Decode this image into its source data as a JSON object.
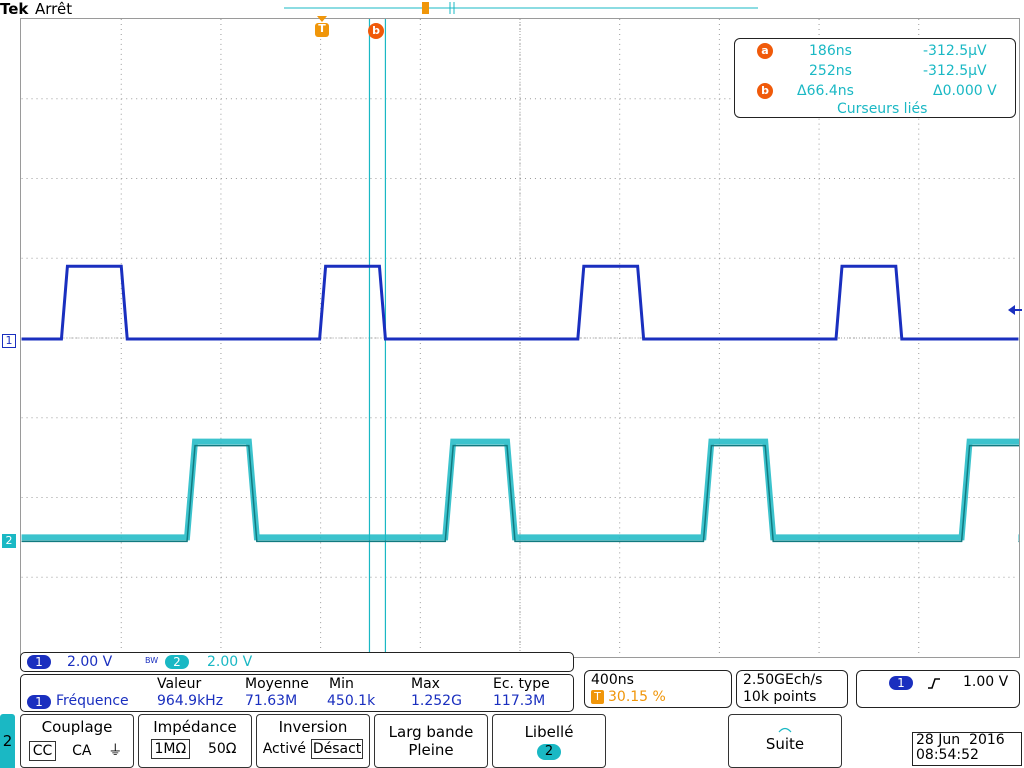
{
  "header": {
    "brand": "Tek",
    "state": "Arrêt"
  },
  "markers": {
    "trigger": "T",
    "cursor_a": "a",
    "cursor_b": "b"
  },
  "channel_markers": {
    "ch1": "1",
    "ch2": "2"
  },
  "cursor_readout": {
    "a_time": "186ns",
    "a_value": "-312.5μV",
    "b_time": "252ns",
    "b_value": "-312.5μV",
    "delta_time": "Δ66.4ns",
    "delta_value": "Δ0.000 V",
    "mode": "Curseurs liés"
  },
  "channel_settings": {
    "ch1_id": "1",
    "ch1_scale": "2.00 V",
    "bw_marker": "BW",
    "ch2_id": "2",
    "ch2_scale": "2.00 V"
  },
  "measurement": {
    "headers": {
      "value": "Valeur",
      "mean": "Moyenne",
      "min": "Min",
      "max": "Max",
      "std": "Ec. type"
    },
    "channel": "1",
    "label": "Fréquence",
    "value": "964.9kHz",
    "mean": "71.63M",
    "min": "450.1k",
    "max": "1.252G",
    "std": "117.3M"
  },
  "timebase": {
    "scale": "400ns",
    "trigger_icon": "T",
    "position": "30.15 %"
  },
  "acquisition": {
    "rate": "2.50GEch/s",
    "points": "10k points"
  },
  "trigger": {
    "channel": "1",
    "slope_icon": "rising-edge",
    "level": "1.00 V"
  },
  "menu": {
    "side_channel": "2",
    "coupling": {
      "title": "Couplage",
      "options": [
        "CC",
        "CA",
        "⏚"
      ],
      "selected": 0
    },
    "impedance": {
      "title": "Impédance",
      "options": [
        "1MΩ",
        "50Ω"
      ],
      "selected": 0
    },
    "inversion": {
      "title": "Inversion",
      "options": [
        "Activé",
        "Désact"
      ],
      "selected": 1
    },
    "bandwidth": {
      "title": "Larg bande",
      "value": "Pleine"
    },
    "label": {
      "title": "Libellé",
      "value": "2"
    },
    "next": {
      "label": "Suite"
    }
  },
  "datetime": {
    "date": "28 Jun  2016",
    "time": "08:54:52"
  },
  "colors": {
    "ch1": "#1a2fbf",
    "ch2": "#1ab8c4",
    "cursor": "#1ab8c4",
    "marker": "#f05a0a",
    "trigger": "#f0960a"
  }
}
